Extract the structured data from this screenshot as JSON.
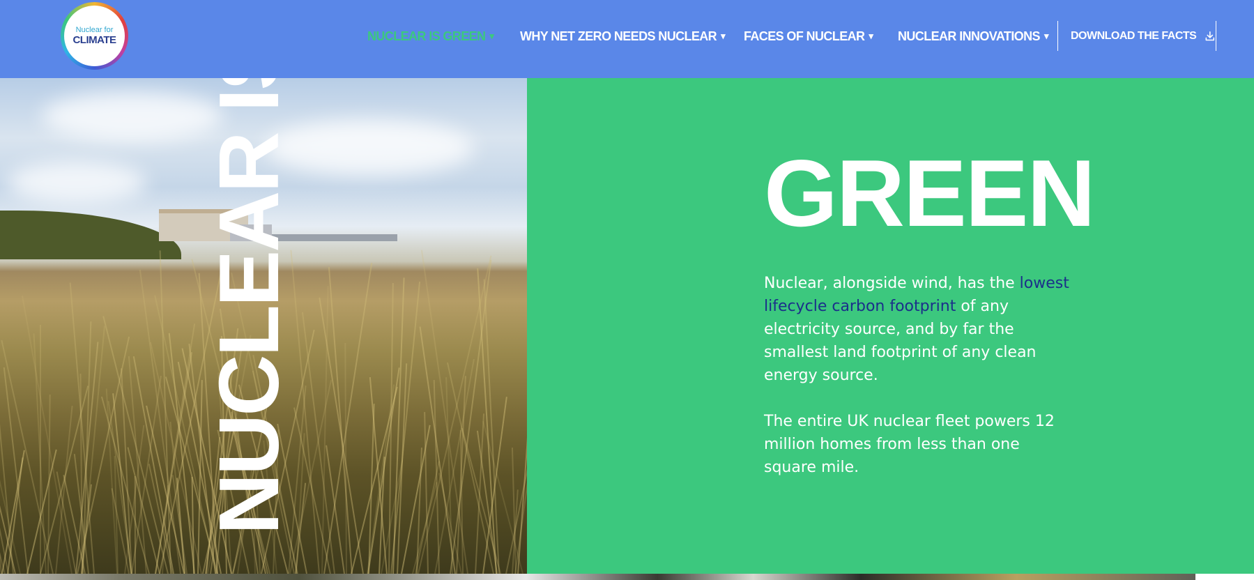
{
  "header": {
    "logo": {
      "line1": "Nuclear for",
      "line2": "CLIMATE"
    },
    "nav": [
      {
        "label": "NUCLEAR IS GREEN",
        "active": true
      },
      {
        "label": "WHY NET ZERO NEEDS NUCLEAR",
        "active": false
      },
      {
        "label": "FACES OF NUCLEAR",
        "active": false
      },
      {
        "label": "NUCLEAR INNOVATIONS",
        "active": false
      }
    ],
    "caret": "▾",
    "download_label": "DOWNLOAD THE FACTS",
    "download_icon": "download-icon"
  },
  "hero": {
    "vertical_title": "NUCLEAR IS",
    "title": "GREEN",
    "para1_pre": "Nuclear, alongside wind, has the ",
    "para1_link": "lowest lifecycle carbon footprint",
    "para1_post": " of any electricity source, and by far the smallest land footprint of any clean energy source.",
    "para2": "The entire UK nuclear fleet powers 12 million homes from less than one square mile."
  },
  "colors": {
    "header_bg": "#5a87e8",
    "accent_green": "#3cc87e",
    "link_blue": "#1b2f8a",
    "text_white": "#ffffff"
  }
}
